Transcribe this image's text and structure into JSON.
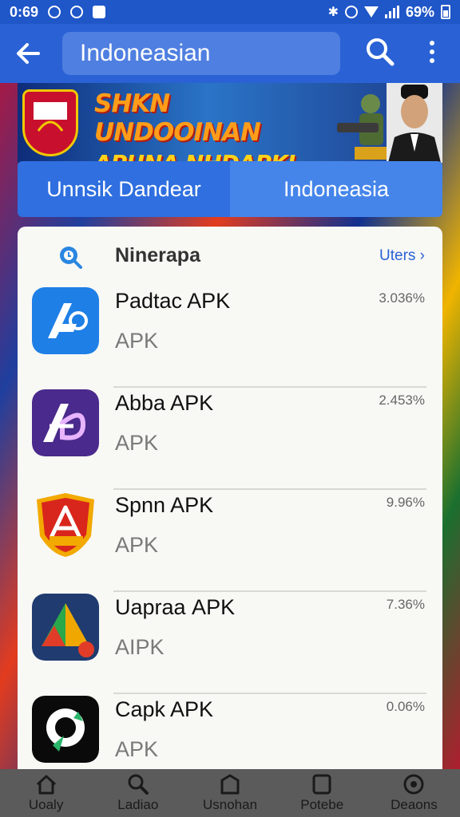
{
  "status_bar": {
    "time": "0:69",
    "battery": "69%"
  },
  "app_bar": {
    "title": "Indoneasian"
  },
  "banner": {
    "line1": "SHKN UNDOOINAN",
    "line2": "APUNA NHDAPKI"
  },
  "tabs": [
    {
      "label": "Unnsik Dandear",
      "active": true
    },
    {
      "label": "Indoneasia",
      "active": false
    }
  ],
  "section": {
    "title": "Ninerapa",
    "link": "Uters ›"
  },
  "apps": [
    {
      "name": "Padtac APK",
      "sub": "APK",
      "percent": "3.036%",
      "icon": "app-logo-blue-icon"
    },
    {
      "name": "Abba APK",
      "sub": "APK",
      "percent": "2.453%",
      "icon": "app-logo-purple-icon"
    },
    {
      "name": "Spnn APK",
      "sub": "APK",
      "percent": "9.96%",
      "icon": "app-logo-shield-icon"
    },
    {
      "name": "Uaprаа APK",
      "sub": "AIPK",
      "percent": "7.36%",
      "icon": "app-logo-triangle-icon"
    },
    {
      "name": "Capk APK",
      "sub": "APK",
      "percent": "0.06%",
      "icon": "app-logo-black-icon"
    }
  ],
  "bottom_nav": [
    {
      "label": "Uoaly",
      "icon": "home-icon"
    },
    {
      "label": "Ladiao",
      "icon": "search-icon"
    },
    {
      "label": "Usnohan",
      "icon": "bag-icon"
    },
    {
      "label": "Potebe",
      "icon": "square-icon"
    },
    {
      "label": "Deaons",
      "icon": "circle-icon"
    }
  ],
  "colors": {
    "primary": "#2a62d6",
    "status_bar": "#1f56c8",
    "card": "#f8f8f5",
    "nav": "#5b5b5b"
  }
}
